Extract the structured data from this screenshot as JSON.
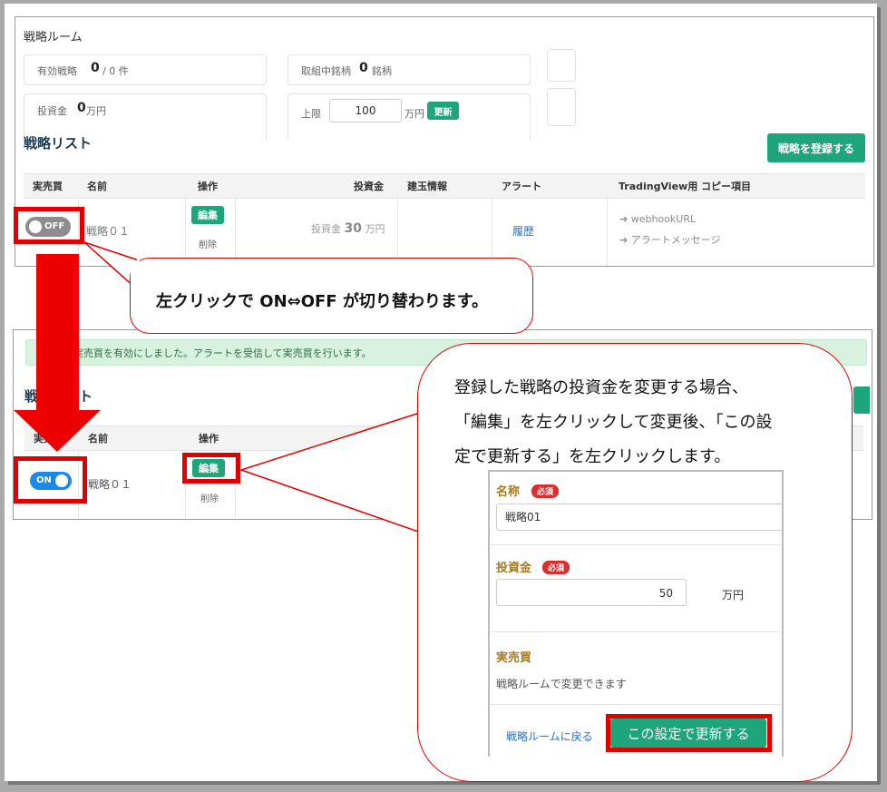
{
  "top": {
    "room_title": "戦略ルーム",
    "stat1": {
      "label": "有効戦略",
      "value": "0",
      "unit": "/ 0 件"
    },
    "stat2": {
      "label": "取組中銘柄",
      "value": "0",
      "unit": "銘柄"
    },
    "stat3": {
      "label": "投資金",
      "value": "0",
      "unit": "万円"
    },
    "limit": {
      "label": "上限",
      "value": "100",
      "unit": "万円",
      "update": "更新"
    },
    "list_title": "戦略リスト",
    "register_button": "戦略を登録する",
    "headers": [
      "実売買",
      "名前",
      "操作",
      "投資金",
      "建玉情報",
      "アラート",
      "TradingView用 コピー項目"
    ],
    "row": {
      "toggle": "OFF",
      "name": "戦略０１",
      "edit": "編集",
      "delete": "削除",
      "investment_label": "投資金",
      "investment_value": "30",
      "investment_unit": "万円",
      "alert_link": "履歴",
      "copy1": "webhookURL",
      "copy2": "アラートメッセージ"
    }
  },
  "callout1": "左クリックで ON⇔OFF が切り替わります。",
  "bottom": {
    "alert_message": "実売買を有効にしました。アラートを受信して実売買を行います。",
    "list_title_partial": "戦略リスト",
    "headers": [
      "実売買",
      "名前",
      "操作"
    ],
    "row": {
      "toggle": "ON",
      "name": "戦略０１",
      "edit": "編集",
      "delete": "削除"
    }
  },
  "callout2": {
    "line1": "登録した戦略の投資金を変更する場合、",
    "line2": "「編集」を左クリックして変更後、「この設",
    "line3": "定で更新する」を左クリックします。"
  },
  "form": {
    "name_label": "名称",
    "required": "必須",
    "name_value": "戦略01",
    "investment_label": "投資金",
    "investment_value": "50",
    "investment_unit": "万円",
    "trade_label": "実売買",
    "trade_note": "戦略ルームで変更できます",
    "back_link": "戦略ルームに戻る",
    "submit": "この設定で更新する"
  },
  "colors": {
    "accent_green": "#1fa57c",
    "annotation_red": "#e00000",
    "toggle_on": "#1e88e5"
  }
}
